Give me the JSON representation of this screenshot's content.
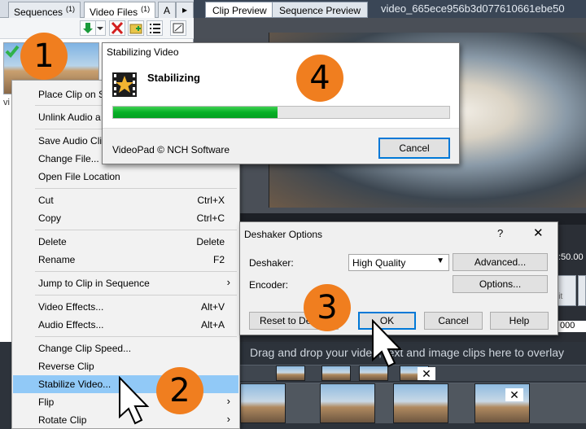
{
  "bin": {
    "tabs": [
      {
        "label": "Sequences",
        "count": "(1)"
      },
      {
        "label": "Video Files",
        "count": "(1)"
      },
      {
        "label": "A",
        "count": ""
      }
    ],
    "clip_label": "vi"
  },
  "preview": {
    "tabs": [
      "Clip Preview",
      "Sequence Preview"
    ],
    "title": "video_665ece956b3d077610661ebe50",
    "timecode": ":50.00",
    "time_field": "000",
    "side_label": "lit"
  },
  "timeline": {
    "overlay_hint": "Drag and drop your video, text and image clips here to overlay"
  },
  "context_menu": {
    "items": [
      {
        "label": "Place Clip on S"
      },
      {
        "label": "Unlink Audio a"
      },
      {
        "label": "Save Audio Clip"
      },
      {
        "label": "Change File..."
      },
      {
        "label": "Open File Location"
      },
      {
        "label": "Cut",
        "shortcut": "Ctrl+X"
      },
      {
        "label": "Copy",
        "shortcut": "Ctrl+C"
      },
      {
        "label": "Delete",
        "shortcut": "Delete"
      },
      {
        "label": "Rename",
        "shortcut": "F2"
      },
      {
        "label": "Jump to Clip in Sequence",
        "submenu": "›"
      },
      {
        "label": "Video Effects...",
        "shortcut": "Alt+V"
      },
      {
        "label": "Audio Effects...",
        "shortcut": "Alt+A"
      },
      {
        "label": "Change Clip Speed..."
      },
      {
        "label": "Reverse Clip"
      },
      {
        "label": "Stabilize Video..."
      },
      {
        "label": "Flip",
        "submenu": "›"
      },
      {
        "label": "Rotate Clip",
        "submenu": "›"
      }
    ]
  },
  "stabilizing_dialog": {
    "title": "Stabilizing Video",
    "heading": "Stabilizing",
    "progress": 0.49,
    "credit": "VideoPad © NCH Software",
    "cancel_label": "Cancel"
  },
  "deshaker_dialog": {
    "title": "Deshaker Options",
    "help_glyph": "?",
    "close_glyph": "✕",
    "deshaker_label": "Deshaker:",
    "deshaker_value": "High Quality",
    "encoder_label": "Encoder:",
    "advanced_label": "Advanced...",
    "options_label": "Options...",
    "reset_label": "Reset to Def",
    "ok_label": "OK",
    "cancel_label": "Cancel",
    "help_label": "Help"
  },
  "badges": [
    "1",
    "2",
    "3",
    "4"
  ],
  "colors": {
    "badge": "#f07e1f",
    "menu_highlight": "#91c9f7",
    "progress": "#06b025",
    "focus_border": "#0078d7"
  }
}
